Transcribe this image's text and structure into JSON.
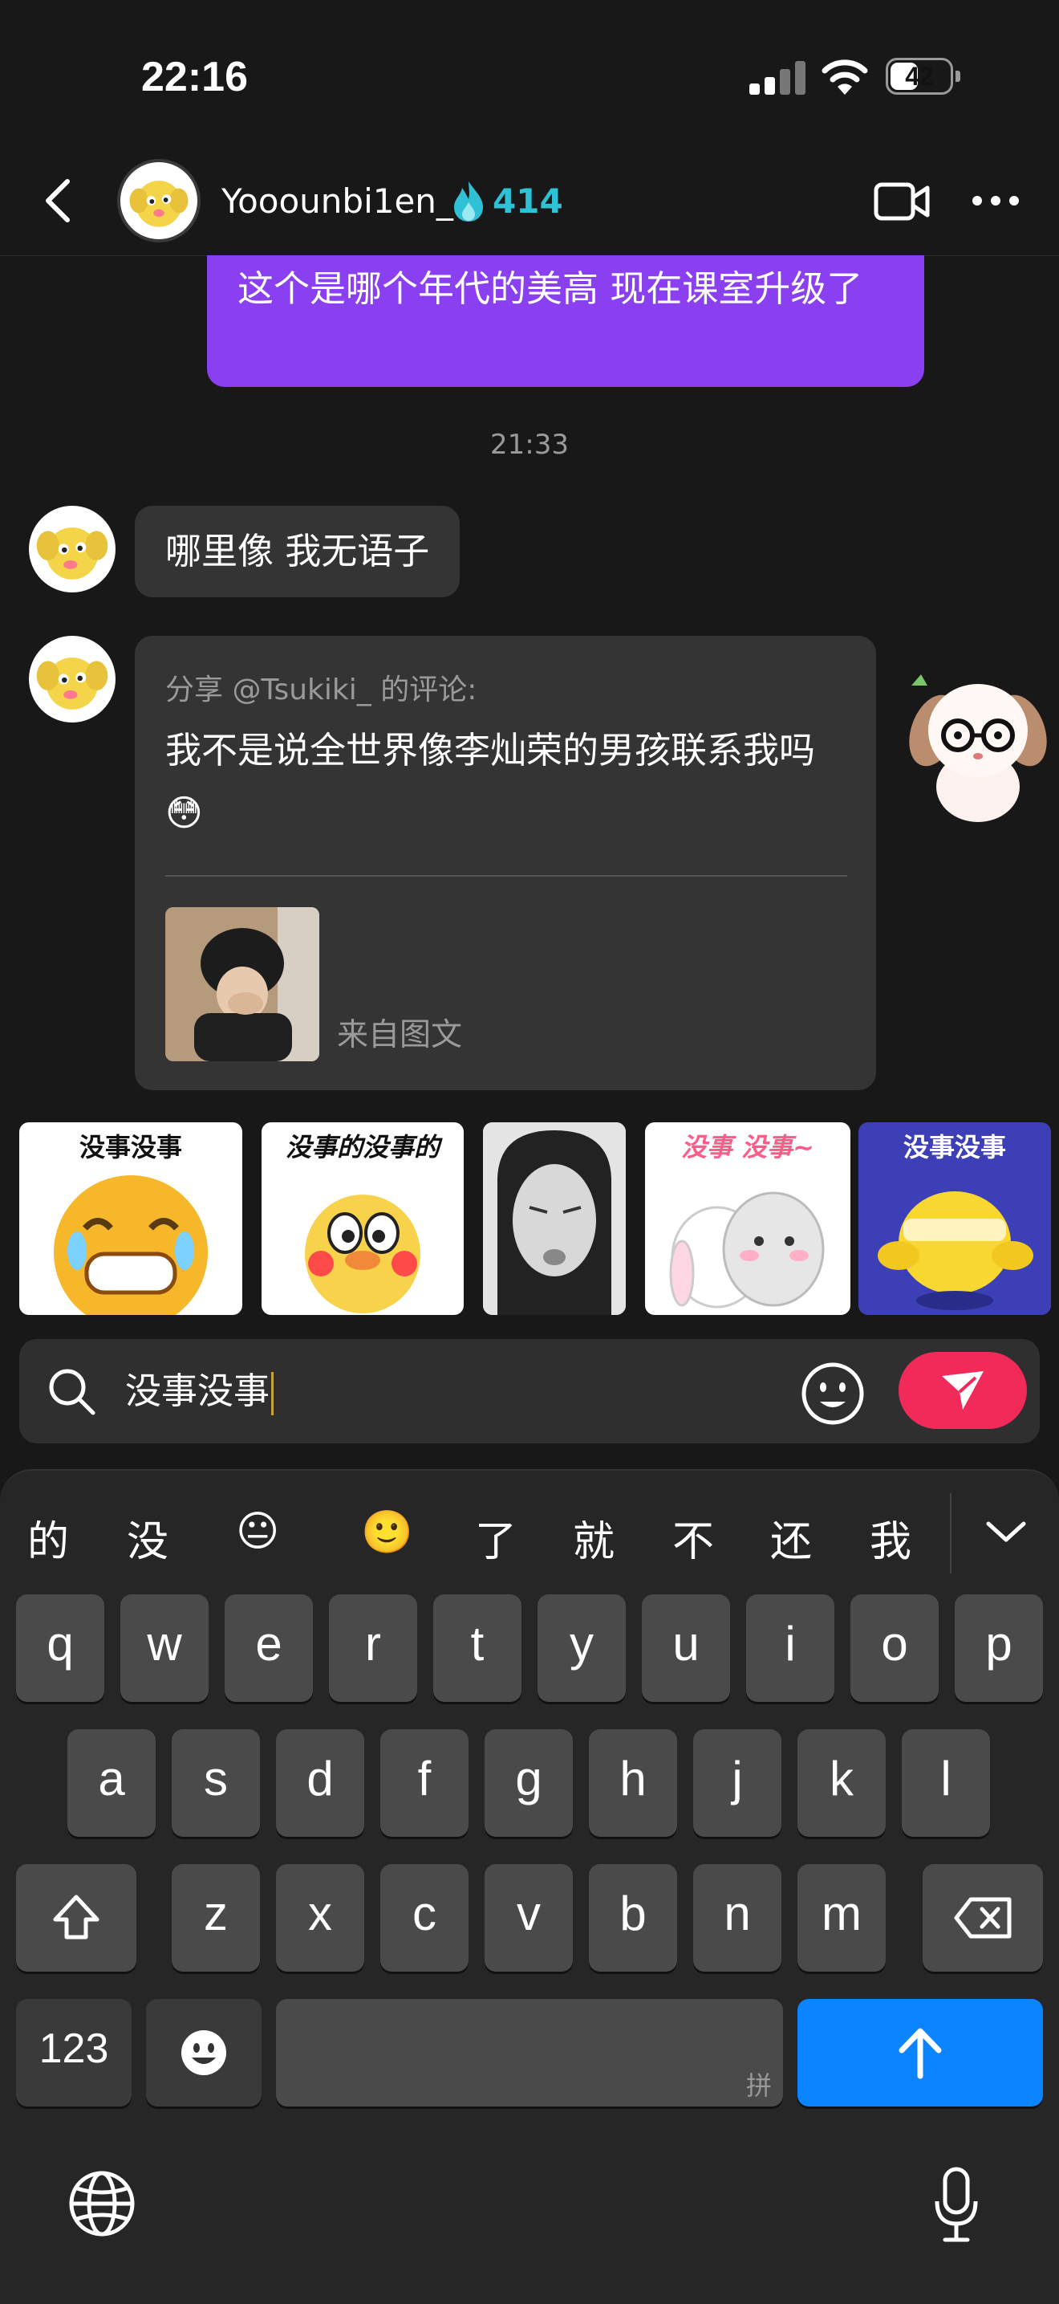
{
  "status": {
    "time": "22:16",
    "battery": "42"
  },
  "header": {
    "username": "Yooounbi1en_",
    "score": "414"
  },
  "messages": {
    "sent_text": "这个是哪个年代的美高 现在课室升级了",
    "timestamp": "21:33",
    "received_text": "哪里像 我无语子",
    "share": {
      "head": "分享 @Tsukiki_ 的评论:",
      "text": "我不是说全世界像李灿荣的男孩联系我吗😳",
      "from": "来自图文"
    }
  },
  "stickers": [
    {
      "caption": "没事没事"
    },
    {
      "caption": "没事的没事的"
    },
    {
      "caption": ""
    },
    {
      "caption": "没事 没事~"
    },
    {
      "caption": "没事没事"
    }
  ],
  "input": {
    "value": "没事没事"
  },
  "keyboard": {
    "candidates": [
      "的",
      "没",
      "😐",
      "🙂",
      "了",
      "就",
      "不",
      "还",
      "我"
    ],
    "row1": [
      "q",
      "w",
      "e",
      "r",
      "t",
      "y",
      "u",
      "i",
      "o",
      "p"
    ],
    "row2": [
      "a",
      "s",
      "d",
      "f",
      "g",
      "h",
      "j",
      "k",
      "l"
    ],
    "row3": [
      "z",
      "x",
      "c",
      "v",
      "b",
      "n",
      "m"
    ],
    "numbers_label": "123",
    "space_hint": "拼"
  },
  "icons": {
    "back": "chevron-left-icon",
    "flame": "flame-icon",
    "video": "video-camera-icon",
    "more": "more-dots-icon",
    "search": "search-icon",
    "emoji": "smiley-icon",
    "send": "paper-plane-icon",
    "shift": "shift-icon",
    "delete": "backspace-icon",
    "return": "arrow-up-icon",
    "globe": "globe-icon",
    "mic": "microphone-icon"
  },
  "colors": {
    "accent_purple": "#8a3ff0",
    "send_red": "#f12a5a",
    "score_teal": "#2fc1d6",
    "return_blue": "#0a84ff"
  }
}
